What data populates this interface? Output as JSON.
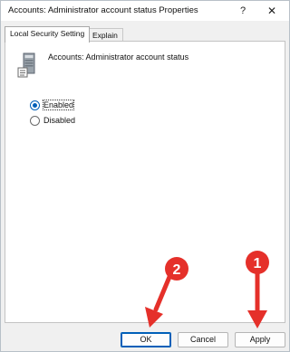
{
  "window": {
    "title": "Accounts: Administrator account status Properties",
    "help_glyph": "?",
    "close_glyph": "✕"
  },
  "tabs": [
    {
      "label": "Local Security Setting",
      "active": true
    },
    {
      "label": "Explain",
      "active": false
    }
  ],
  "policy": {
    "icon": "server-policy-icon",
    "name": "Accounts: Administrator account status"
  },
  "options": [
    {
      "label": "Enabled",
      "checked": true
    },
    {
      "label": "Disabled",
      "checked": false
    }
  ],
  "buttons": {
    "ok": "OK",
    "cancel": "Cancel",
    "apply": "Apply"
  },
  "annotations": [
    {
      "number": "1",
      "target": "apply"
    },
    {
      "number": "2",
      "target": "ok"
    }
  ],
  "colors": {
    "accent": "#005fb8",
    "annotation": "#e5302a"
  }
}
